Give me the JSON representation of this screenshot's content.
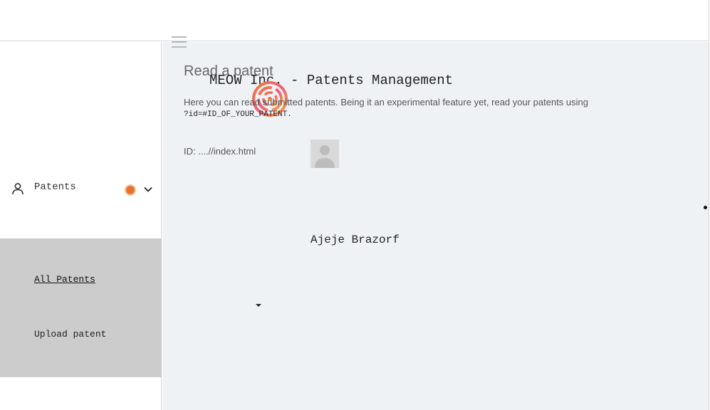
{
  "header": {
    "app_title": "MEOW Inc. - Patents Management"
  },
  "sidebar": {
    "group": {
      "label": "Patents",
      "icon": "user-icon",
      "expand_icon": "chevron-down-icon",
      "status_color": "#e8742e"
    },
    "items": [
      {
        "label": "All Patents",
        "active": true
      },
      {
        "label": "Upload patent",
        "active": false
      }
    ]
  },
  "main": {
    "heading": "Read a patent",
    "intro": "Here you can read submitted patents. Being it an experimental feature yet, read your patents using",
    "intro_code": "?id=#ID_OF_YOUR_PATENT.",
    "id_line": "ID: ....//index.html",
    "author": "Ajeje Brazorf"
  },
  "colors": {
    "main_background": "#eff2f5",
    "submenu_background": "#cccccc",
    "accent": "#e8742e"
  }
}
